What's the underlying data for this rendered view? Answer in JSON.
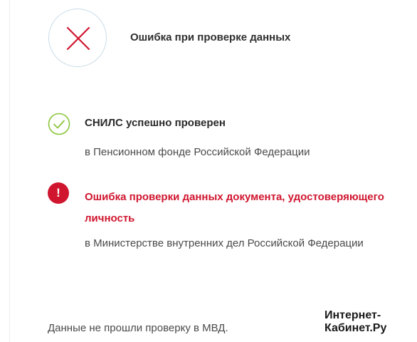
{
  "header": {
    "icon": "close-x-icon",
    "title": "Ошибка при проверке данных"
  },
  "checks": [
    {
      "status": "success",
      "icon": "check-circle-icon",
      "title": "СНИЛС успешно проверен",
      "subtitle": "в Пенсионном фонде Российской Федерации"
    },
    {
      "status": "error",
      "icon": "exclamation-icon",
      "icon_glyph": "!",
      "title": "Ошибка проверки данных документа, удостоверяющего личность",
      "subtitle": "в Министерстве внутренних дел Российской Федерации"
    }
  ],
  "footer": {
    "note": "Данные не прошли проверку в МВД."
  },
  "watermark": {
    "line1": "Интернет-",
    "line2": "Кабинет.Ру"
  },
  "colors": {
    "error": "#d0162f",
    "success": "#8cc63f",
    "circle_border": "#c9dce8",
    "text": "#2a2a2a"
  }
}
